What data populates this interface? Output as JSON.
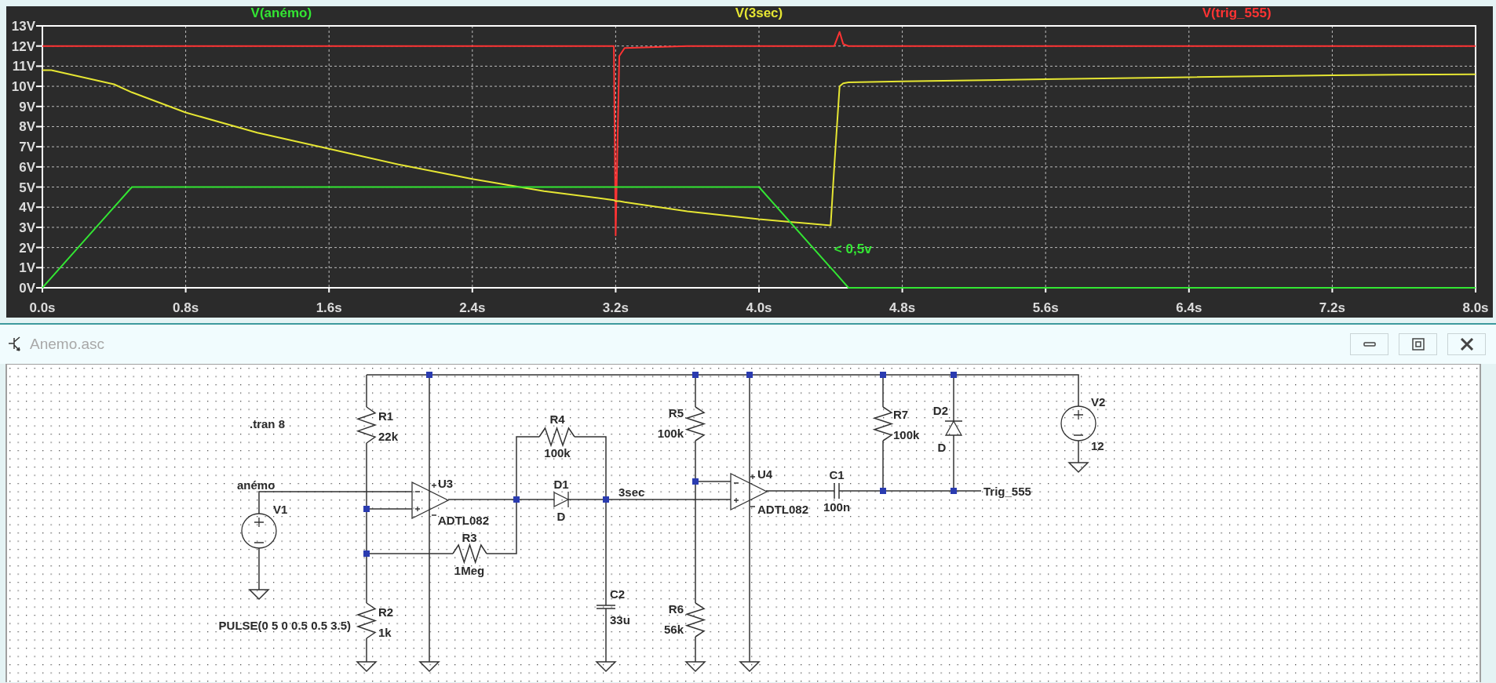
{
  "plot": {
    "chart_data": {
      "type": "line",
      "xlim": [
        0,
        8
      ],
      "ylim": [
        0,
        13
      ],
      "x": [
        0,
        0.05,
        0.4,
        0.5,
        0.8,
        1.2,
        1.6,
        2.0,
        2.4,
        2.8,
        3.19,
        3.2,
        3.22,
        3.25,
        3.6,
        4.0,
        4.4,
        4.42,
        4.45,
        4.47,
        4.5,
        4.8,
        5.6,
        6.4,
        7.2,
        8.0
      ],
      "series": [
        {
          "name": "V(anémo)",
          "color": "#33e633",
          "values": [
            0,
            0.5,
            4,
            5,
            5,
            5,
            5,
            5,
            5,
            5,
            5,
            5,
            5,
            5,
            5,
            5,
            1,
            0.8,
            0.5,
            0.3,
            0,
            0,
            0,
            0,
            0,
            0
          ]
        },
        {
          "name": "V(3sec)",
          "color": "#e6e633",
          "values": [
            10.8,
            10.8,
            10.1,
            9.7,
            8.7,
            7.7,
            6.9,
            6.1,
            5.4,
            4.8,
            4.35,
            4.3,
            4.3,
            4.25,
            3.8,
            3.4,
            3.1,
            6,
            10,
            10.15,
            10.2,
            10.25,
            10.35,
            10.45,
            10.55,
            10.6
          ]
        },
        {
          "name": "V(trig_555)",
          "color": "#ff3333",
          "values": [
            12,
            12,
            12,
            12,
            12,
            12,
            12,
            12,
            12,
            12,
            12,
            2.6,
            11.5,
            11.9,
            12,
            12,
            12,
            12,
            12.7,
            12.1,
            12,
            12,
            12,
            12,
            12,
            12
          ]
        }
      ],
      "xticks": [
        {
          "value": 0,
          "label": "0.0s"
        },
        {
          "value": 0.8,
          "label": "0.8s"
        },
        {
          "value": 1.6,
          "label": "1.6s"
        },
        {
          "value": 2.4,
          "label": "2.4s"
        },
        {
          "value": 3.2,
          "label": "3.2s"
        },
        {
          "value": 4.0,
          "label": "4.0s"
        },
        {
          "value": 4.8,
          "label": "4.8s"
        },
        {
          "value": 5.6,
          "label": "5.6s"
        },
        {
          "value": 6.4,
          "label": "6.4s"
        },
        {
          "value": 7.2,
          "label": "7.2s"
        },
        {
          "value": 8.0,
          "label": "8.0s"
        }
      ],
      "yticks": [
        {
          "value": 0,
          "label": "0V"
        },
        {
          "value": 1,
          "label": "1V"
        },
        {
          "value": 2,
          "label": "2V"
        },
        {
          "value": 3,
          "label": "3V"
        },
        {
          "value": 4,
          "label": "4V"
        },
        {
          "value": 5,
          "label": "5V"
        },
        {
          "value": 6,
          "label": "6V"
        },
        {
          "value": 7,
          "label": "7V"
        },
        {
          "value": 8,
          "label": "8V"
        },
        {
          "value": 9,
          "label": "9V"
        },
        {
          "value": 10,
          "label": "10V"
        },
        {
          "value": 11,
          "label": "11V"
        },
        {
          "value": 12,
          "label": "12V"
        },
        {
          "value": 13,
          "label": "13V"
        }
      ],
      "grid": true,
      "annotations": [
        "< 0,5v"
      ]
    }
  },
  "schematic": {
    "title": "Anemo.asc",
    "components": [
      {
        "kind": "resistor",
        "name": "R1",
        "value": "22k"
      },
      {
        "kind": "resistor",
        "name": "R2",
        "value": "1k"
      },
      {
        "kind": "resistor",
        "name": "R3",
        "value": "1Meg"
      },
      {
        "kind": "resistor",
        "name": "R4",
        "value": "100k"
      },
      {
        "kind": "resistor",
        "name": "R5",
        "value": "100k"
      },
      {
        "kind": "resistor",
        "name": "R6",
        "value": "56k"
      },
      {
        "kind": "resistor",
        "name": "R7",
        "value": "100k"
      },
      {
        "kind": "opamp",
        "name": "U3",
        "value": "ADTL082"
      },
      {
        "kind": "opamp",
        "name": "U4",
        "value": "ADTL082"
      },
      {
        "kind": "diode",
        "name": "D1",
        "value": "D"
      },
      {
        "kind": "diode",
        "name": "D2",
        "value": "D"
      },
      {
        "kind": "capacitor",
        "name": "C1",
        "value": "100n"
      },
      {
        "kind": "capacitor",
        "name": "C2",
        "value": "33u"
      },
      {
        "kind": "source",
        "name": "V1",
        "value": "PULSE(0 5 0 0.5 0.5 3.5)"
      },
      {
        "kind": "source",
        "name": "V2",
        "value": "12"
      }
    ],
    "net_labels": [
      "anémo",
      "3sec",
      "Trig_555"
    ],
    "directives": [
      ".tran 8"
    ]
  }
}
